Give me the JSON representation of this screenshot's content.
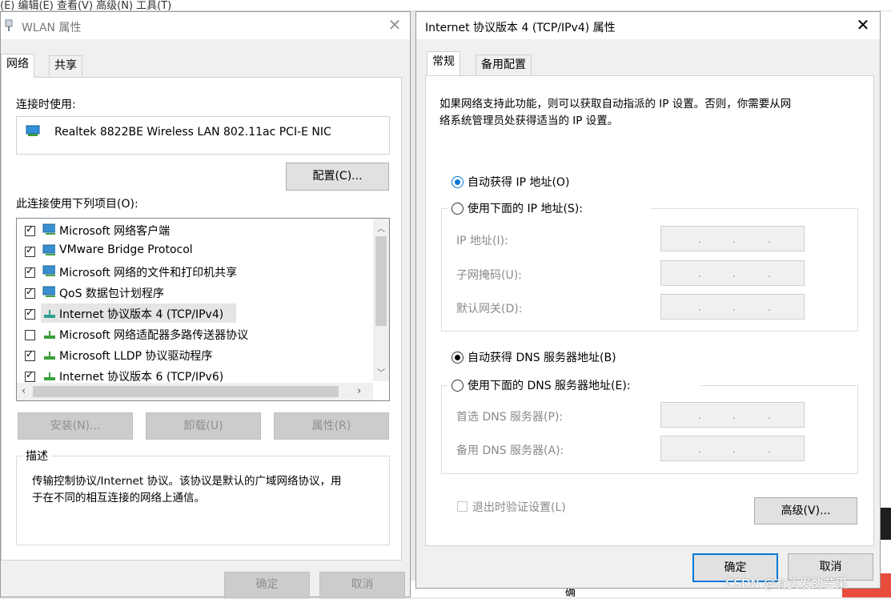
{
  "background": {
    "menu_fragment": "(E)    编辑(E)    查看(V)    高级(N)    工具(T)",
    "bottom_char": "确"
  },
  "wlan": {
    "title": "WLAN 属性",
    "tabs": [
      {
        "label": "网络",
        "active": true
      },
      {
        "label": "共享",
        "active": false
      }
    ],
    "connect_using_label": "连接时使用:",
    "adapter_name": "Realtek 8822BE Wireless LAN 802.11ac PCI-E NIC",
    "configure_button": "配置(C)...",
    "items_label": "此连接使用下列项目(O):",
    "items": [
      {
        "label": "Microsoft 网络客户端",
        "checked": true,
        "icon": "network-client-icon"
      },
      {
        "label": "VMware Bridge Protocol",
        "checked": true,
        "icon": "network-client-icon"
      },
      {
        "label": "Microsoft 网络的文件和打印机共享",
        "checked": true,
        "icon": "network-client-icon"
      },
      {
        "label": "QoS 数据包计划程序",
        "checked": true,
        "icon": "network-client-icon"
      },
      {
        "label": "Internet 协议版本 4 (TCP/IPv4)",
        "checked": true,
        "icon": "protocol-icon",
        "selected": true
      },
      {
        "label": "Microsoft 网络适配器多路传送器协议",
        "checked": false,
        "icon": "protocol-icon"
      },
      {
        "label": "Microsoft LLDP 协议驱动程序",
        "checked": true,
        "icon": "protocol-icon"
      },
      {
        "label": "Internet 协议版本 6 (TCP/IPv6)",
        "checked": true,
        "icon": "protocol-icon"
      }
    ],
    "install_button": "安装(N)...",
    "uninstall_button": "卸载(U)",
    "properties_button": "属性(R)",
    "description_title": "描述",
    "description_line1": "传输控制协议/Internet 协议。该协议是默认的广域网络协议，用",
    "description_line2": "于在不同的相互连接的网络上通信。",
    "ok_button": "确定",
    "cancel_button": "取消"
  },
  "ipv4": {
    "title": "Internet 协议版本 4 (TCP/IPv4) 属性",
    "tabs": [
      {
        "label": "常规",
        "active": true
      },
      {
        "label": "备用配置",
        "active": false
      }
    ],
    "intro_line1": "如果网络支持此功能，则可以获取自动指派的 IP 设置。否则，你需要从网",
    "intro_line2": "络系统管理员处获得适当的 IP 设置。",
    "auto_ip_label": "自动获得 IP 地址(O)",
    "manual_ip_label": "使用下面的 IP 地址(S):",
    "ip_address_label": "IP 地址(I):",
    "subnet_label": "子网掩码(U):",
    "gateway_label": "默认网关(D):",
    "auto_dns_label": "自动获得 DNS 服务器地址(B)",
    "manual_dns_label": "使用下面的 DNS 服务器地址(E):",
    "preferred_dns_label": "首选 DNS 服务器(P):",
    "alternate_dns_label": "备用 DNS 服务器(A):",
    "validate_label": "退出时验证设置(L)",
    "advanced_button": "高级(V)...",
    "ok_button": "确定",
    "cancel_button": "取消",
    "ip_mode": "auto",
    "dns_mode": "auto"
  },
  "watermark": "CSDN @有头发的芒果"
}
